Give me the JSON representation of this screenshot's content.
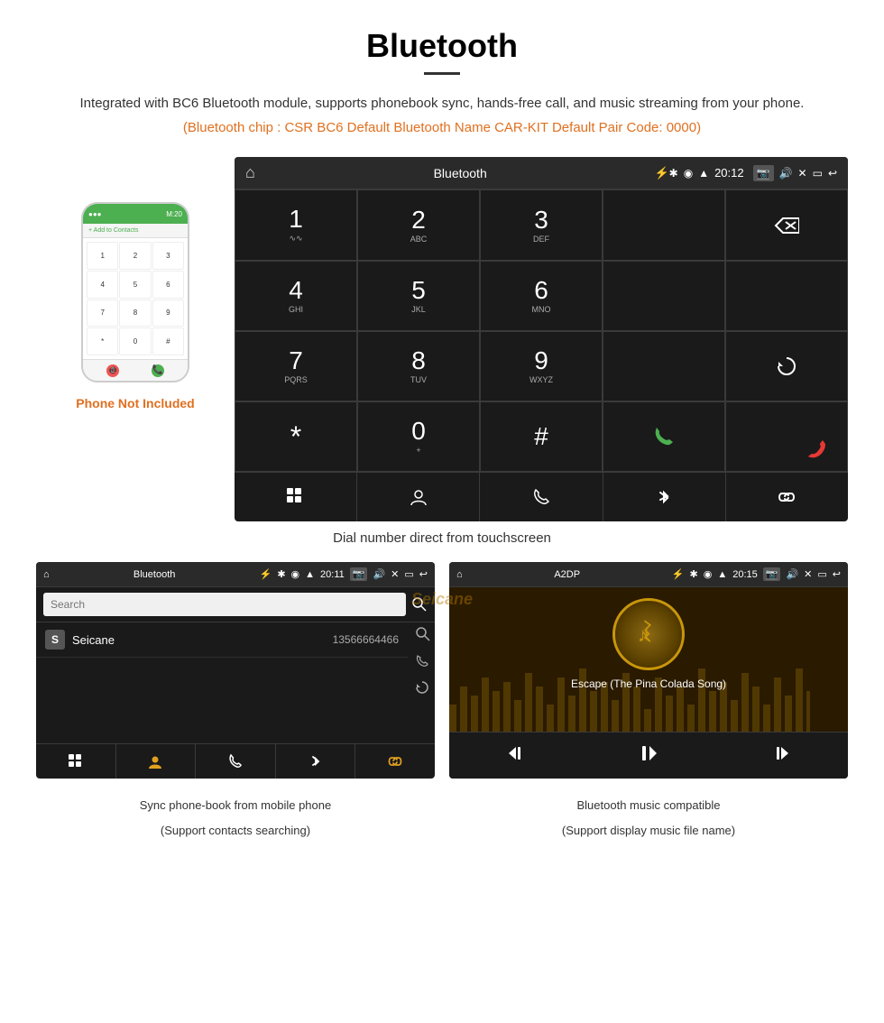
{
  "header": {
    "title": "Bluetooth",
    "subtitle": "Integrated with BC6 Bluetooth module, supports phonebook sync, hands-free call, and music streaming from your phone.",
    "info_line": "(Bluetooth chip : CSR BC6   Default Bluetooth Name CAR-KIT   Default Pair Code: 0000)"
  },
  "phone_label": "Phone Not Included",
  "dialer": {
    "status_bar": {
      "title": "Bluetooth",
      "time": "20:12"
    },
    "keys": [
      {
        "num": "1",
        "letters": "∿∿"
      },
      {
        "num": "2",
        "letters": "ABC"
      },
      {
        "num": "3",
        "letters": "DEF"
      },
      {
        "num": "",
        "letters": ""
      },
      {
        "num": "⌫",
        "letters": ""
      },
      {
        "num": "4",
        "letters": "GHI"
      },
      {
        "num": "5",
        "letters": "JKL"
      },
      {
        "num": "6",
        "letters": "MNO"
      },
      {
        "num": "",
        "letters": ""
      },
      {
        "num": "",
        "letters": ""
      },
      {
        "num": "7",
        "letters": "PQRS"
      },
      {
        "num": "8",
        "letters": "TUV"
      },
      {
        "num": "9",
        "letters": "WXYZ"
      },
      {
        "num": "",
        "letters": ""
      },
      {
        "num": "↺",
        "letters": ""
      },
      {
        "num": "✱",
        "letters": ""
      },
      {
        "num": "0",
        "letters": "+"
      },
      {
        "num": "#",
        "letters": ""
      },
      {
        "num": "📞",
        "letters": ""
      },
      {
        "num": "📵",
        "letters": ""
      }
    ],
    "bottom_actions": [
      "⊞",
      "👤",
      "📞",
      "✱",
      "🔗"
    ]
  },
  "dialer_caption": "Dial number direct from touchscreen",
  "phonebook": {
    "status_bar_title": "Bluetooth",
    "status_bar_time": "20:11",
    "search_placeholder": "Search",
    "contact": {
      "letter": "S",
      "name": "Seicane",
      "phone": "13566664466"
    },
    "bottom_icons": [
      "⊞",
      "👤",
      "📞",
      "✱",
      "🔗"
    ]
  },
  "music": {
    "status_bar_title": "A2DP",
    "status_bar_time": "20:15",
    "song_title": "Escape (The Pina Colada Song)",
    "controls": [
      "⏮",
      "⏭⏸",
      "⏭"
    ]
  },
  "captions": {
    "phonebook": "Sync phone-book from mobile phone\n(Support contacts searching)",
    "phonebook_line1": "Sync phone-book from mobile phone",
    "phonebook_line2": "(Support contacts searching)",
    "music": "Bluetooth music compatible",
    "music_line1": "Bluetooth music compatible",
    "music_line2": "(Support display music file name)"
  }
}
